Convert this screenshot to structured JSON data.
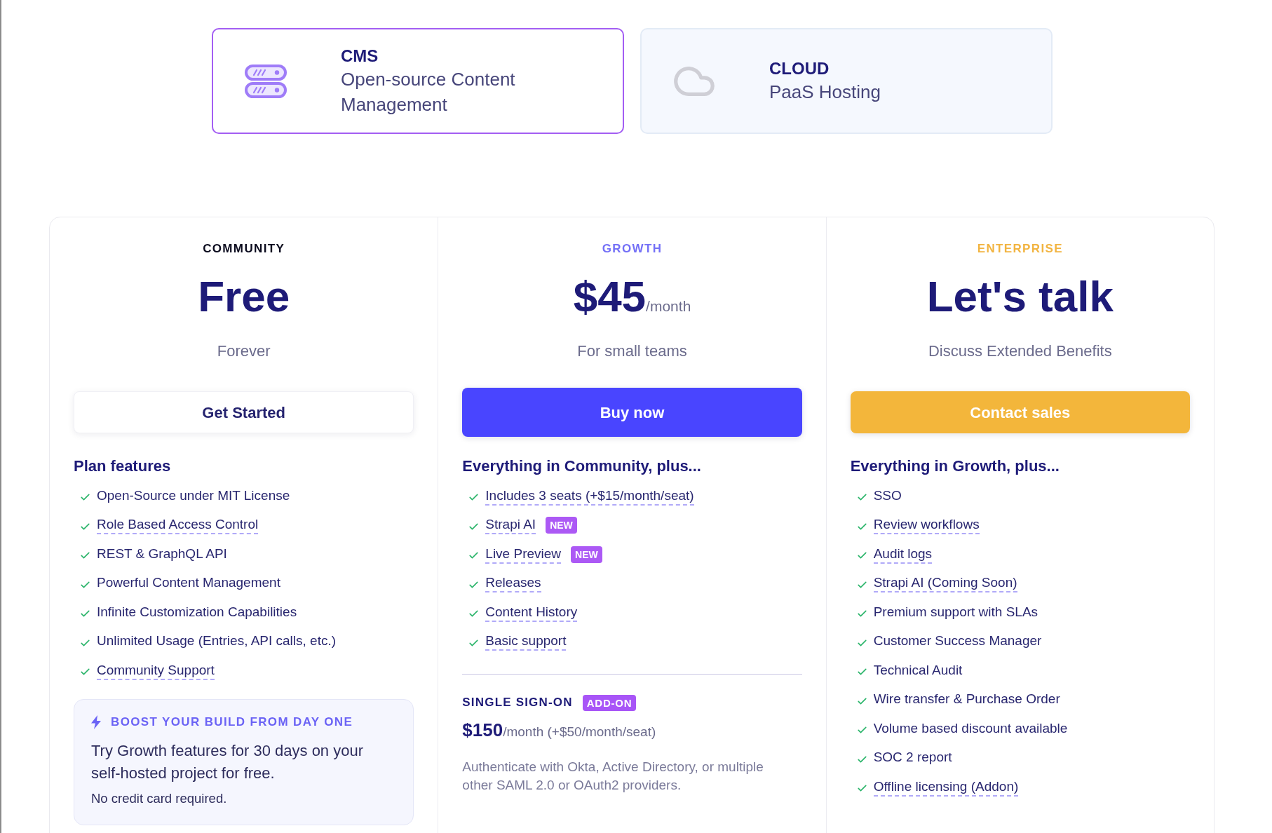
{
  "products": [
    {
      "title": "CMS",
      "subtitle": "Open-source Content Management",
      "selected": true
    },
    {
      "title": "CLOUD",
      "subtitle": "PaaS Hosting",
      "selected": false
    }
  ],
  "plans": [
    {
      "tier": "COMMUNITY",
      "color": "#0b0b1e",
      "price": "Free",
      "subtitle": "Forever",
      "featured": false,
      "button": {
        "label": "Get Started",
        "kind": "outline"
      },
      "features_title": "Plan features",
      "features": [
        {
          "text": "Open-Source under MIT License",
          "underlined": false
        },
        {
          "text": "Role Based Access Control",
          "underlined": true
        },
        {
          "text": "REST & GraphQL API",
          "underlined": false
        },
        {
          "text": "Powerful Content Management",
          "underlined": false
        },
        {
          "text": "Infinite Customization Capabilities",
          "underlined": false
        },
        {
          "text": "Unlimited Usage (Entries, API calls, etc.)",
          "underlined": false
        },
        {
          "text": "Community Support",
          "underlined": true
        }
      ],
      "promo": {
        "title": "BOOST YOUR BUILD FROM DAY ONE",
        "text": "Try Growth features for 30 days on your self-hosted project for free.",
        "note": "No credit card required."
      }
    },
    {
      "tier": "GROWTH",
      "color": "#7470f7",
      "price": "$45",
      "price_unit": "/month",
      "subtitle": "For small teams",
      "featured": true,
      "button": {
        "label": "Buy now",
        "kind": "solid",
        "color": "#4945ff"
      },
      "features_title": "Everything in Community, plus...",
      "features": [
        {
          "text": "Includes 3 seats (+$15/month/seat)",
          "underlined": true
        },
        {
          "text": "Strapi AI",
          "underlined": true,
          "badge": "NEW"
        },
        {
          "text": "Live Preview",
          "underlined": true,
          "badge": "NEW"
        },
        {
          "text": "Releases",
          "underlined": true
        },
        {
          "text": "Content History",
          "underlined": true
        },
        {
          "text": "Basic support",
          "underlined": true
        }
      ],
      "addon": {
        "title": "SINGLE SIGN-ON",
        "badge": "ADD-ON",
        "price": "$150",
        "price_note": "/month (+$50/month/seat)",
        "description": "Authenticate with Okta, Active Directory, or multiple other SAML 2.0 or OAuth2 providers."
      }
    },
    {
      "tier": "ENTERPRISE",
      "color": "#f2b441",
      "price": "Let's talk",
      "subtitle": "Discuss Extended Benefits",
      "featured": false,
      "button": {
        "label": "Contact sales",
        "kind": "solid",
        "color": "#f3b63b"
      },
      "features_title": "Everything in Growth, plus...",
      "features": [
        {
          "text": "SSO",
          "underlined": false
        },
        {
          "text": "Review workflows",
          "underlined": true
        },
        {
          "text": "Audit logs",
          "underlined": true
        },
        {
          "text": "Strapi AI (Coming Soon)",
          "underlined": true
        },
        {
          "text": "Premium support with SLAs",
          "underlined": false
        },
        {
          "text": "Customer Success Manager",
          "underlined": false
        },
        {
          "text": "Technical Audit",
          "underlined": false
        },
        {
          "text": "Wire transfer & Purchase Order",
          "underlined": false
        },
        {
          "text": "Volume based discount available",
          "underlined": false
        },
        {
          "text": "SOC 2 report",
          "underlined": false
        },
        {
          "text": "Offline licensing (Addon)",
          "underlined": true
        }
      ]
    }
  ]
}
